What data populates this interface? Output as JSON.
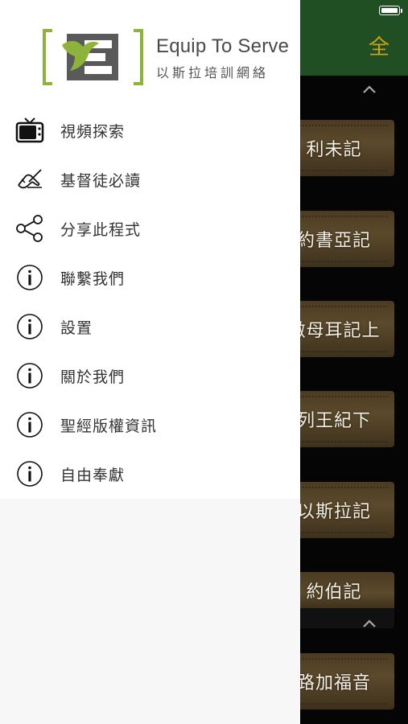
{
  "status_bar": {
    "battery_icon": "battery-full-icon"
  },
  "background_app": {
    "header_button": "全",
    "header_color": "#1f4f22",
    "accent_color": "#c7a21a",
    "books": [
      {
        "label": "利未記"
      },
      {
        "label": "約書亞記"
      },
      {
        "label": "撒母耳記上"
      },
      {
        "label": "列王紀下"
      },
      {
        "label": "以斯拉記"
      },
      {
        "label": "約伯記"
      },
      {
        "label": "路加福音"
      }
    ]
  },
  "drawer": {
    "brand": {
      "name": "Equip To Serve",
      "subtitle": "以斯拉培訓網絡",
      "accent_color": "#8db33a"
    },
    "menu": [
      {
        "label": "視頻探索",
        "icon": "tv-icon"
      },
      {
        "label": "基督徒必讀",
        "icon": "writing-hand-icon"
      },
      {
        "label": "分享此程式",
        "icon": "share-icon"
      },
      {
        "label": "聯繫我們",
        "icon": "info-icon"
      },
      {
        "label": "設置",
        "icon": "info-icon"
      },
      {
        "label": "關於我們",
        "icon": "info-icon"
      },
      {
        "label": "聖經版權資訊",
        "icon": "info-icon"
      },
      {
        "label": "自由奉獻",
        "icon": "info-icon"
      }
    ]
  }
}
